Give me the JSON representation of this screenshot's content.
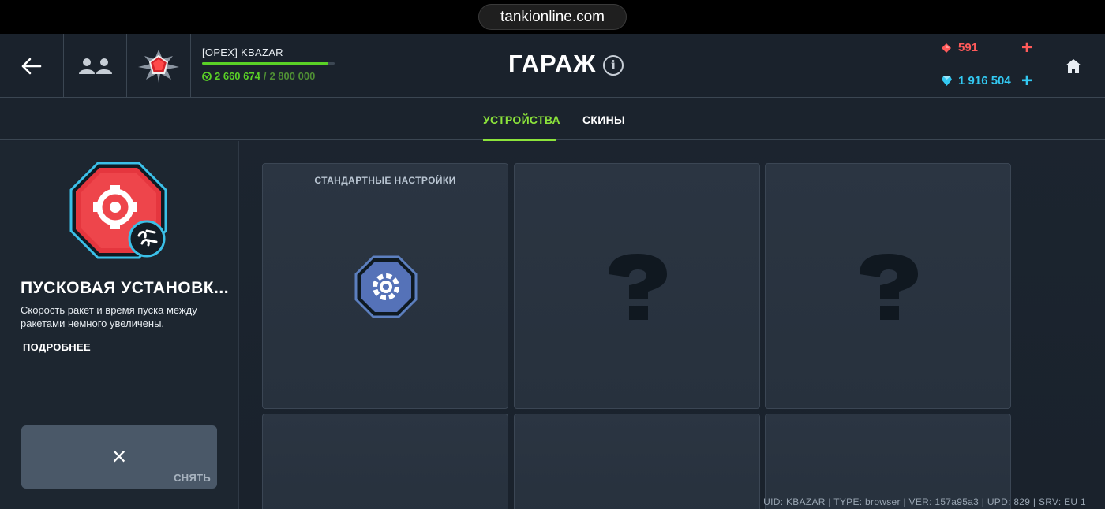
{
  "browser": {
    "url": "tankionline.com"
  },
  "header": {
    "player_name": "[OPEX] KBAZAR",
    "xp_current": "2 660 674",
    "xp_separator": " / ",
    "xp_max": "2 800 000",
    "xp_progress_fraction": 0.95,
    "title": "ГАРАЖ",
    "info_label": "i",
    "rubies": "591",
    "crystals": "1 916 504",
    "plus_label": "+"
  },
  "tabs": [
    {
      "label": "УСТРОЙСТВА",
      "active": true
    },
    {
      "label": "СКИНЫ",
      "active": false
    }
  ],
  "device": {
    "name": "ПУСКОВАЯ УСТАНОВК...",
    "description": "Скорость ракет и время пуска между ракетами немного увеличены.",
    "more_label": "ПОДРОБНЕЕ",
    "remove_icon": "×",
    "remove_label": "СНЯТЬ"
  },
  "grid": {
    "cards": [
      {
        "caption": "СТАНДАРТНЫЕ НАСТРОЙКИ",
        "icon": "gear-icon"
      },
      {
        "caption": "",
        "icon": "question-icon"
      },
      {
        "caption": "",
        "icon": "question-icon"
      },
      {
        "caption": "",
        "icon": "question-icon"
      },
      {
        "caption": "",
        "icon": "question-icon"
      },
      {
        "caption": "",
        "icon": "question-icon"
      }
    ]
  },
  "footer": {
    "info": "UID: KBAZAR | TYPE: browser | VER: 157a95a3 | UPD: 829 | SRV: EU 1"
  },
  "colors": {
    "accent_green": "#8ce43b",
    "xp_green": "#5ad126",
    "ruby": "#ff5a5a",
    "crystal": "#33c9f2"
  }
}
